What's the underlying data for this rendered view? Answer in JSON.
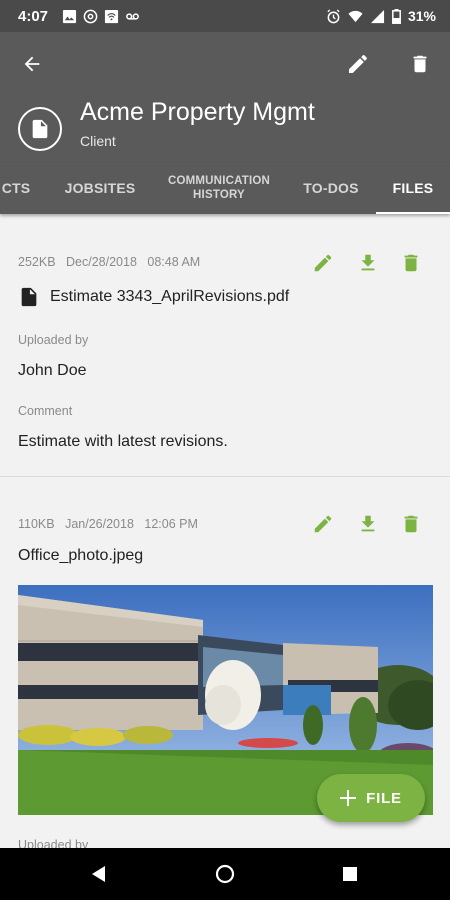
{
  "status_bar": {
    "time": "4:07",
    "battery": "31%",
    "left_icons": [
      "image-icon",
      "at-sign-icon",
      "wifi-calling-icon",
      "voicemail-icon"
    ],
    "right_icons": [
      "alarm-icon",
      "wifi-icon",
      "signal-icon",
      "battery-icon"
    ]
  },
  "header": {
    "client_name": "Acme Property Mgmt",
    "client_type": "Client",
    "icons": [
      "back-arrow-icon",
      "pencil-icon",
      "trash-icon",
      "document-icon"
    ]
  },
  "tabs": [
    {
      "label": "CTS",
      "active": false
    },
    {
      "label": "JOBSITES",
      "active": false
    },
    {
      "label": "COMMUNICATION HISTORY",
      "active": false
    },
    {
      "label": "TO-DOS",
      "active": false
    },
    {
      "label": "FILES",
      "active": true
    }
  ],
  "files": [
    {
      "size": "252KB",
      "date": "Dec/28/2018",
      "time": "08:48 AM",
      "name": "Estimate 3343_AprilRevisions.pdf",
      "uploaded_by_label": "Uploaded by",
      "uploaded_by": "John Doe",
      "comment_label": "Comment",
      "comment": "Estimate with latest revisions."
    },
    {
      "size": "110KB",
      "date": "Jan/26/2018",
      "time": "12:06 PM",
      "name": "Office_photo.jpeg",
      "uploaded_by_label": "Uploaded by"
    }
  ],
  "fab": {
    "label": "FILE",
    "icon": "plus-icon"
  },
  "nav": {
    "icons": [
      "back-triangle-icon",
      "home-circle-icon",
      "recents-square-icon"
    ]
  },
  "colors": {
    "appbar": "#5a5a5a",
    "status_bar": "#4a4a4a",
    "accent_green": "#7cb342",
    "background": "#f2f2f2"
  }
}
